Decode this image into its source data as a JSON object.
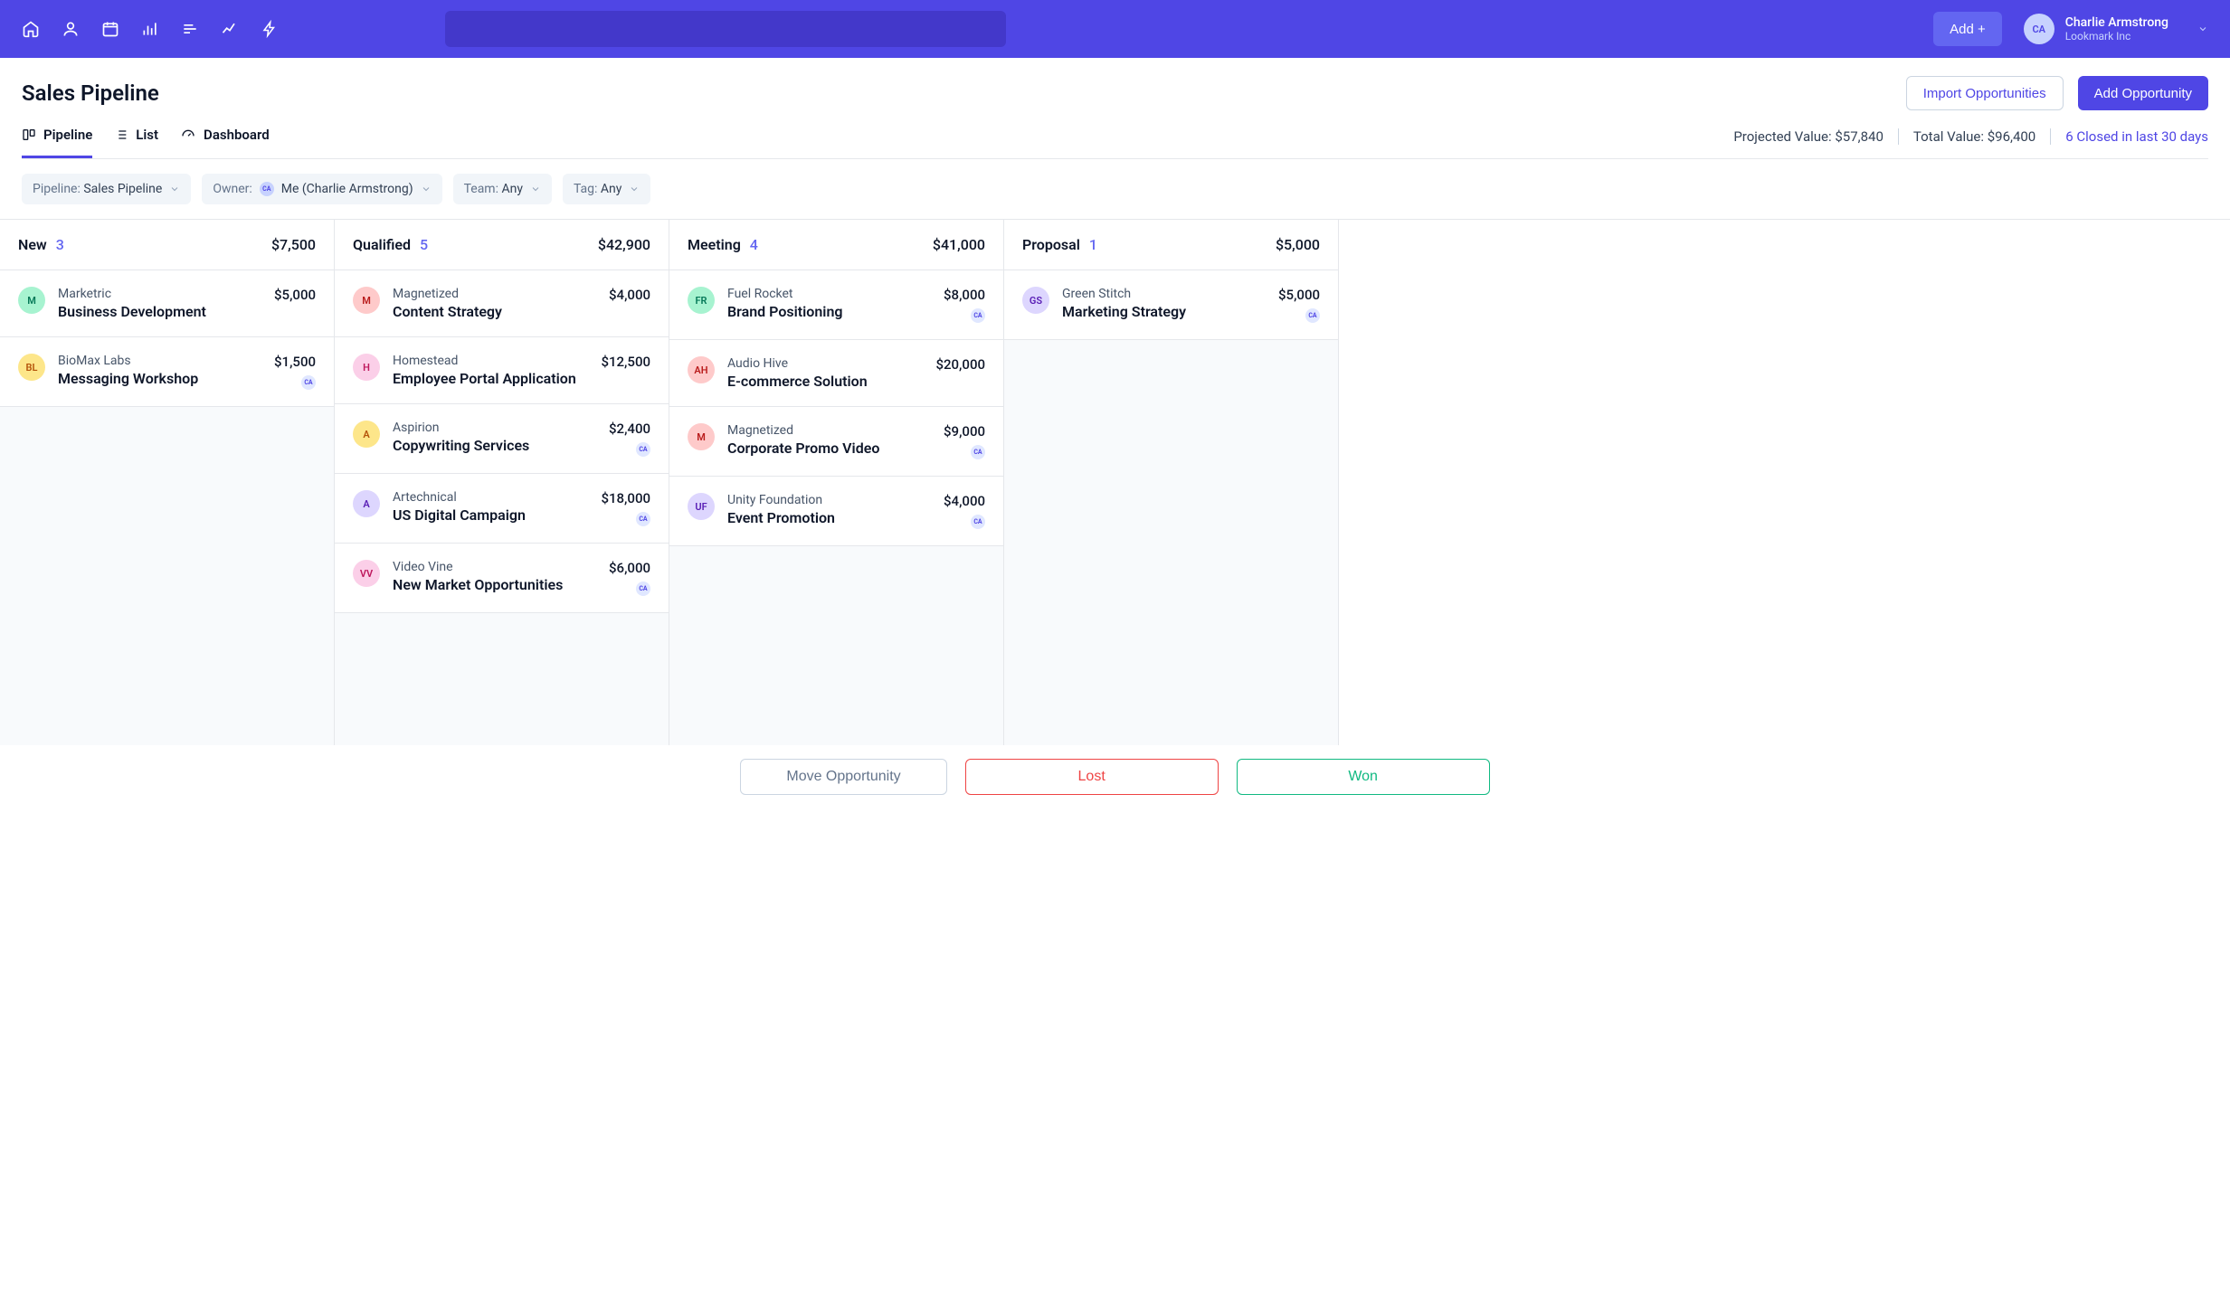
{
  "topbar": {
    "add_label": "Add +",
    "user": {
      "initials": "CA",
      "name": "Charlie Armstrong",
      "company": "Lookmark Inc"
    }
  },
  "header": {
    "title": "Sales Pipeline",
    "import_btn": "Import Opportunities",
    "add_btn": "Add Opportunity",
    "tabs": {
      "pipeline": "Pipeline",
      "list": "List",
      "dashboard": "Dashboard"
    },
    "stats": {
      "projected_label": "Projected Value: ",
      "projected_value": "$57,840",
      "total_label": "Total Value: ",
      "total_value": "$96,400",
      "closed": "6 Closed in last 30 days"
    }
  },
  "filters": {
    "pipeline_label": "Pipeline: ",
    "pipeline_value": "Sales Pipeline",
    "owner_label": "Owner:",
    "owner_value": "Me (Charlie Armstrong)",
    "owner_initials": "CA",
    "team_label": "Team: ",
    "team_value": "Any",
    "tag_label": "Tag: ",
    "tag_value": "Any"
  },
  "columns": [
    {
      "name": "New",
      "count": "3",
      "total": "$7,500",
      "cards": [
        {
          "company": "Marketric",
          "title": "Business Development",
          "price": "$5,000",
          "av": "M",
          "bg": "#a7f3d0",
          "fg": "#047857",
          "owner": null
        },
        {
          "company": "BioMax Labs",
          "title": "Messaging Workshop",
          "price": "$1,500",
          "av": "BL",
          "bg": "#fde68a",
          "fg": "#b45309",
          "owner": "CA"
        }
      ]
    },
    {
      "name": "Qualified",
      "count": "5",
      "total": "$42,900",
      "cards": [
        {
          "company": "Magnetized",
          "title": "Content Strategy",
          "price": "$4,000",
          "av": "M",
          "bg": "#fecaca",
          "fg": "#b91c1c",
          "owner": null
        },
        {
          "company": "Homestead",
          "title": "Employee Portal Application",
          "price": "$12,500",
          "av": "H",
          "bg": "#fbcfe8",
          "fg": "#be185d",
          "owner": null
        },
        {
          "company": "Aspirion",
          "title": "Copywriting Services",
          "price": "$2,400",
          "av": "A",
          "bg": "#fde68a",
          "fg": "#b45309",
          "owner": "CA"
        },
        {
          "company": "Artechnical",
          "title": "US Digital Campaign",
          "price": "$18,000",
          "av": "A",
          "bg": "#ddd6fe",
          "fg": "#5b21b6",
          "owner": "CA"
        },
        {
          "company": "Video Vine",
          "title": "New Market Opportunities",
          "price": "$6,000",
          "av": "VV",
          "bg": "#fbcfe8",
          "fg": "#be185d",
          "owner": "CA"
        }
      ]
    },
    {
      "name": "Meeting",
      "count": "4",
      "total": "$41,000",
      "cards": [
        {
          "company": "Fuel Rocket",
          "title": "Brand Positioning",
          "price": "$8,000",
          "av": "FR",
          "bg": "#a7f3d0",
          "fg": "#047857",
          "owner": "CA"
        },
        {
          "company": "Audio Hive",
          "title": "E-commerce Solution",
          "price": "$20,000",
          "av": "AH",
          "bg": "#fecaca",
          "fg": "#b91c1c",
          "owner": null
        },
        {
          "company": "Magnetized",
          "title": "Corporate Promo Video",
          "price": "$9,000",
          "av": "M",
          "bg": "#fecaca",
          "fg": "#b91c1c",
          "owner": "CA"
        },
        {
          "company": "Unity Foundation",
          "title": "Event Promotion",
          "price": "$4,000",
          "av": "UF",
          "bg": "#ddd6fe",
          "fg": "#5b21b6",
          "owner": "CA"
        }
      ]
    },
    {
      "name": "Proposal",
      "count": "1",
      "total": "$5,000",
      "cards": [
        {
          "company": "Green Stitch",
          "title": "Marketing Strategy",
          "price": "$5,000",
          "av": "GS",
          "bg": "#ddd6fe",
          "fg": "#5b21b6",
          "owner": "CA"
        }
      ]
    }
  ],
  "footer": {
    "move": "Move Opportunity",
    "lost": "Lost",
    "won": "Won"
  }
}
